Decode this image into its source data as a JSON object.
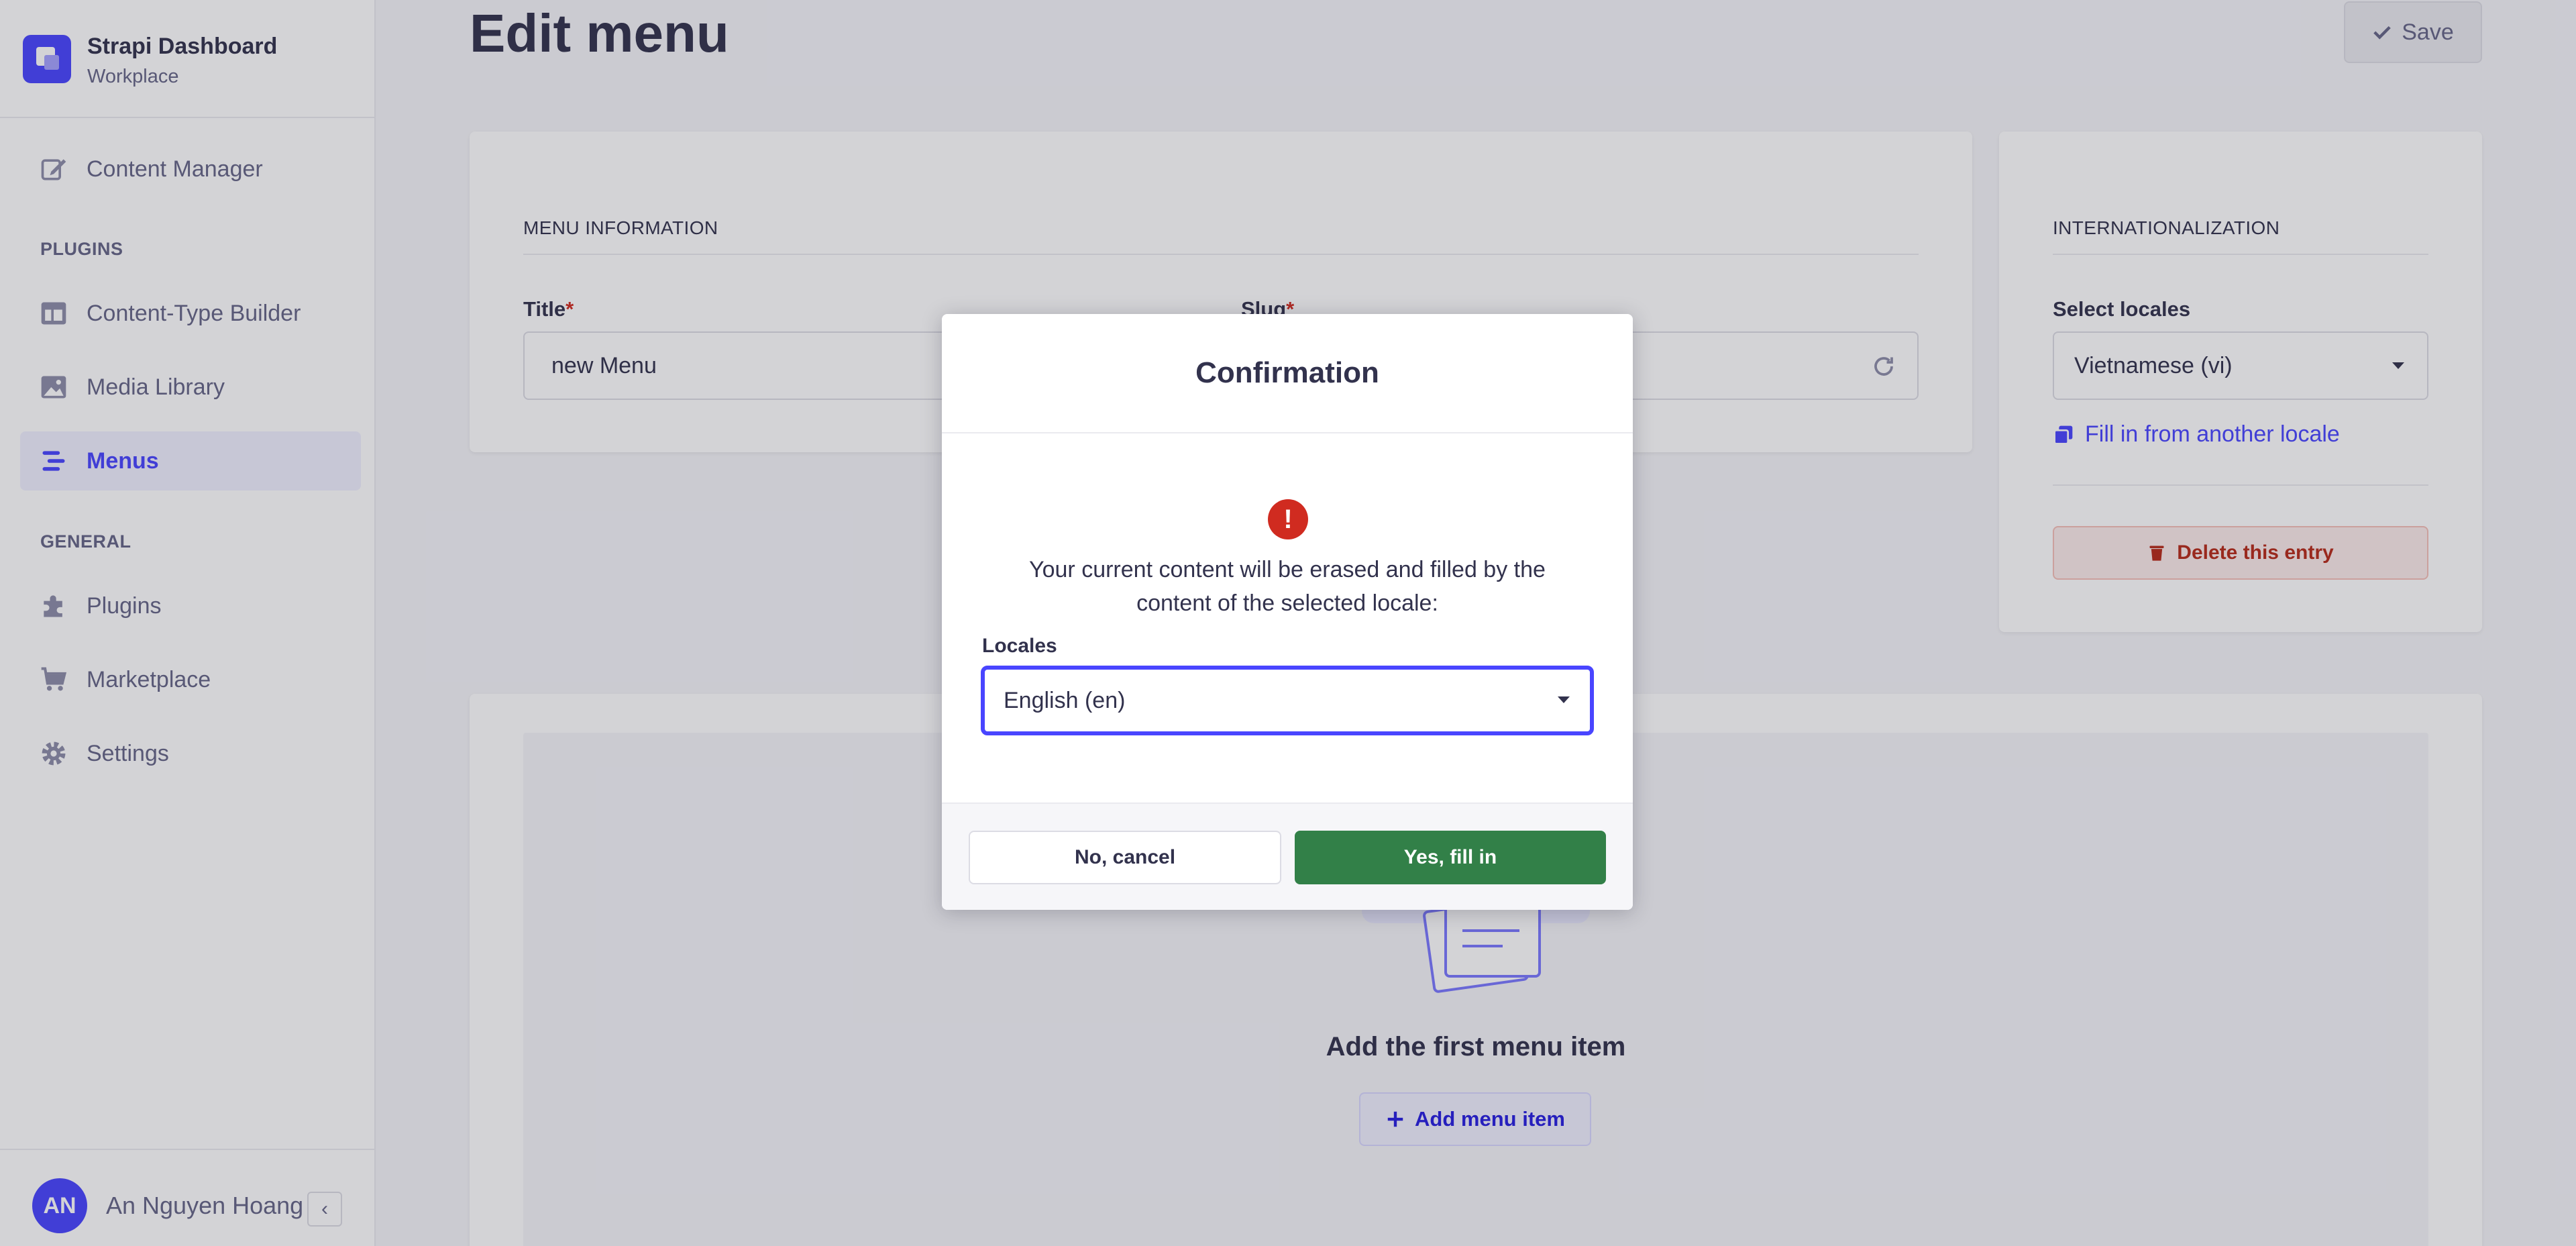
{
  "colors": {
    "primary": "#4945ff",
    "success": "#328048",
    "danger": "#d02b20",
    "text": "#32324d",
    "muted": "#666687"
  },
  "brand": {
    "title": "Strapi Dashboard",
    "subtitle": "Workplace"
  },
  "sidebar": {
    "content_manager": "Content Manager",
    "plugins_heading": "PLUGINS",
    "content_type_builder": "Content-Type Builder",
    "media_library": "Media Library",
    "menus": "Menus",
    "general_heading": "GENERAL",
    "plugins": "Plugins",
    "marketplace": "Marketplace",
    "settings": "Settings"
  },
  "user": {
    "initials": "AN",
    "name": "An Nguyen Hoang"
  },
  "header": {
    "title": "Edit menu",
    "save_label": "Save"
  },
  "menu_info": {
    "section_title": "MENU INFORMATION",
    "title_label": "Title",
    "title_value": "new Menu",
    "slug_label": "Slug",
    "required_mark": "*"
  },
  "i18n": {
    "section_title": "INTERNATIONALIZATION",
    "select_label": "Select locales",
    "selected_locale": "Vietnamese (vi)",
    "fill_link": "Fill in from another locale",
    "delete_label": "Delete this entry"
  },
  "empty": {
    "title": "Add the first menu item",
    "add_label": "Add menu item"
  },
  "modal": {
    "title": "Confirmation",
    "message": "Your current content will be erased and filled by the content of the selected locale:",
    "field_label": "Locales",
    "selected": "English (en)",
    "cancel_label": "No, cancel",
    "confirm_label": "Yes, fill in"
  }
}
